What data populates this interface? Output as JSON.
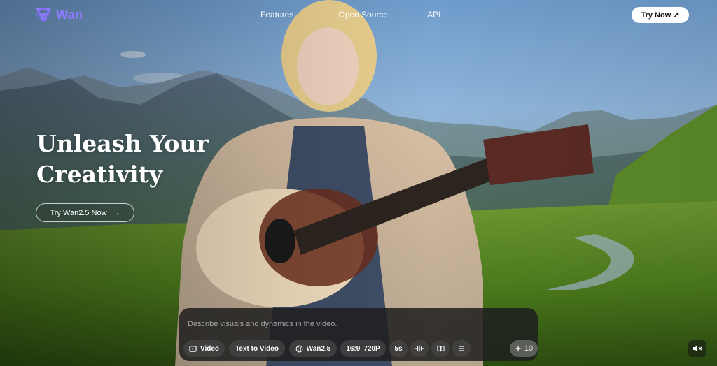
{
  "brand": {
    "name": "Wan",
    "color": "#8f7bff"
  },
  "nav": {
    "links": [
      "Features",
      "Open Source",
      "API"
    ],
    "try_now": "Try Now ↗"
  },
  "hero": {
    "headline_line1": "Unleash Your",
    "headline_line2": "Creativity",
    "cta_label": "Try Wan2.5 Now",
    "cta_arrow": "→"
  },
  "prompt_panel": {
    "placeholder": "Describe visuals and dynamics in the video.",
    "chips": {
      "video": "Video",
      "mode": "Text to Video",
      "model": "Wan2.5",
      "aspect": "16:9",
      "resolution": "720P",
      "duration": "5s"
    },
    "credits": "10"
  },
  "icons": {
    "logo": "wan-logo-icon",
    "video": "video-icon",
    "model": "globe-icon",
    "audio": "waveform-icon",
    "book": "book-icon",
    "menu": "list-icon",
    "credits": "sparkle-icon",
    "mute": "speaker-muted-icon"
  }
}
